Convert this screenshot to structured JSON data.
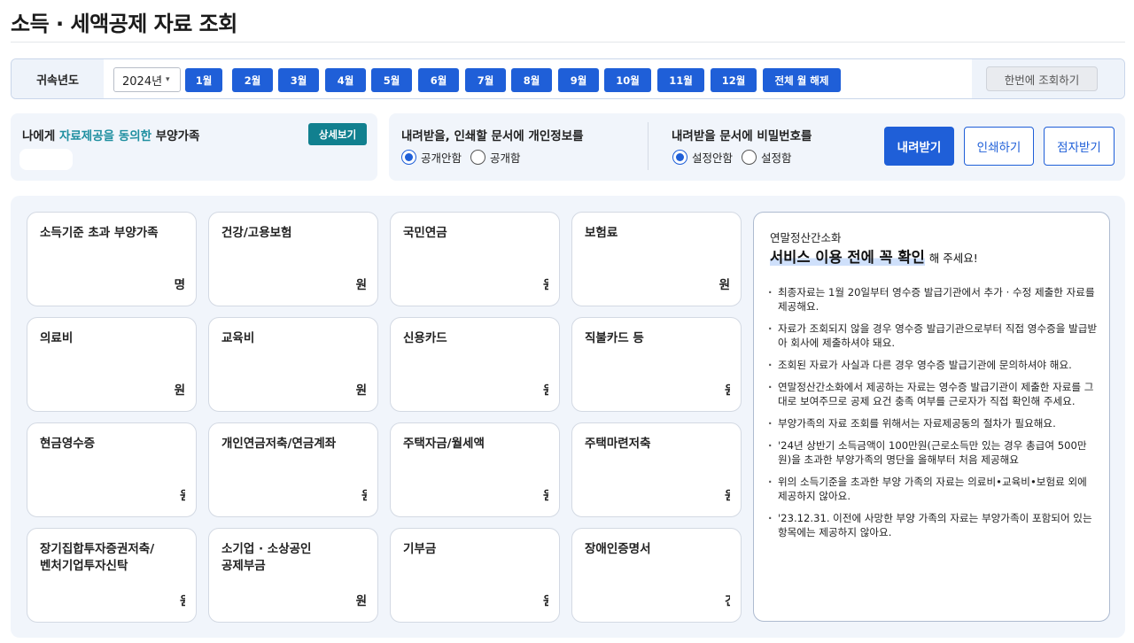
{
  "page": {
    "title": "소득 · 세액공제 자료 조회"
  },
  "yearbar": {
    "label": "귀속년도",
    "year_value": "2024년",
    "months": [
      "1월",
      "2월",
      "3월",
      "4월",
      "5월",
      "6월",
      "7월",
      "8월",
      "9월",
      "10월",
      "11월",
      "12월"
    ],
    "clear_all_label": "전체 월 해제",
    "query_all_label": "한번에 조회하기"
  },
  "dependents": {
    "title_prefix": "나에게 ",
    "title_highlight": "자료제공을 동의한",
    "title_suffix": " 부양가족",
    "detail_label": "상세보기"
  },
  "options": {
    "privacy": {
      "title": "내려받을, 인쇄할 문서에 개인정보를",
      "option1": "공개안함",
      "option2": "공개함",
      "selected": "공개안함"
    },
    "password": {
      "title": "내려받을 문서에 비밀번호를",
      "option1": "설정안함",
      "option2": "설정함",
      "selected": "설정안함"
    },
    "download_label": "내려받기",
    "print_label": "인쇄하기",
    "braille_label": "점자받기"
  },
  "cards": [
    {
      "title": "소득기준 초과 부양가족",
      "unit": "명"
    },
    {
      "title": "건강/고용보험",
      "unit": "원"
    },
    {
      "title": "국민연금",
      "unit": "원"
    },
    {
      "title": "보험료",
      "unit": "원"
    },
    {
      "title": "의료비",
      "unit": "원"
    },
    {
      "title": "교육비",
      "unit": "원"
    },
    {
      "title": "신용카드",
      "unit": "원"
    },
    {
      "title": "직불카드 등",
      "unit": "원"
    },
    {
      "title": "현금영수증",
      "unit": "원"
    },
    {
      "title": "개인연금저축/연금계좌",
      "unit": "원"
    },
    {
      "title": "주택자금/월세액",
      "unit": "원"
    },
    {
      "title": "주택마련저축",
      "unit": "원"
    },
    {
      "title": "장기집합투자증권저축/",
      "title2": "벤처기업투자신탁",
      "unit": "원"
    },
    {
      "title": "소기업 · 소상공인",
      "title2": "공제부금",
      "unit": "원"
    },
    {
      "title": "기부금",
      "unit": "원"
    },
    {
      "title": "장애인증명서",
      "unit": "건"
    }
  ],
  "notice": {
    "kicker": "연말정산간소화",
    "headline": "서비스 이용 전에 꼭 확인",
    "headline_tail": "해 주세요!",
    "items": [
      "최종자료는 1월 20일부터 영수증 발급기관에서 추가 · 수정 제출한 자료를 제공해요.",
      "자료가 조회되지 않을 경우 영수증 발급기관으로부터 직접 영수증을 발급받아 회사에 제출하셔야 돼요.",
      "조회된 자료가 사실과 다른 경우 영수증 발급기관에 문의하셔야 해요.",
      "연말정산간소화에서 제공하는 자료는 영수증 발급기관이 제출한 자료를 그대로 보여주므로 공제 요건 충족 여부를 근로자가 직접 확인해 주세요.",
      "부양가족의 자료 조회를 위해서는 자료제공동의 절차가 필요해요.",
      "'24년 상반기 소득금액이 100만원(근로소득만 있는 경우 총급여 500만원)을 초과한 부양가족의 명단을 올해부터 처음 제공해요",
      "위의 소득기준을 초과한 부양 가족의 자료는 의료비•교육비•보험료 외에 제공하지 않아요.",
      "'23.12.31. 이전에 사망한 부양 가족의 자료는 부양가족이 포함되어 있는 항목에는 제공하지 않아요."
    ]
  }
}
